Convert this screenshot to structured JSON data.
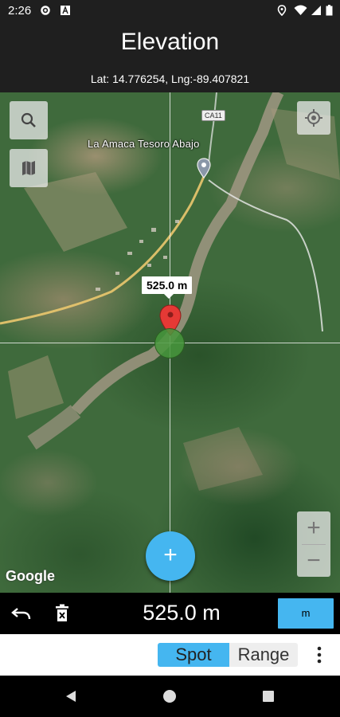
{
  "status_bar": {
    "time": "2:26",
    "left_icons": [
      "gear-icon",
      "a-box-icon"
    ],
    "right_icons": [
      "location-icon",
      "wifi-icon",
      "signal-icon",
      "battery-icon"
    ]
  },
  "header": {
    "title": "Elevation",
    "coordinates": "Lat: 14.776254, Lng:-89.407821"
  },
  "map": {
    "place_label": "La Amaca Tesoro Abajo",
    "road_badge": "CA11",
    "marker_label": "525.0 m",
    "attribution": "Google",
    "zoom_in_label": "+",
    "zoom_out_label": "−",
    "fab_label": "+"
  },
  "readout": {
    "value": "525.0 m",
    "unit_button": "m"
  },
  "mode": {
    "spot_label": "Spot",
    "range_label": "Range",
    "selected": "Spot"
  },
  "colors": {
    "accent": "#45b6f0",
    "bar_bg": "#1f1f1f",
    "marker_red": "#e53935",
    "marker_green": "#46963c"
  }
}
